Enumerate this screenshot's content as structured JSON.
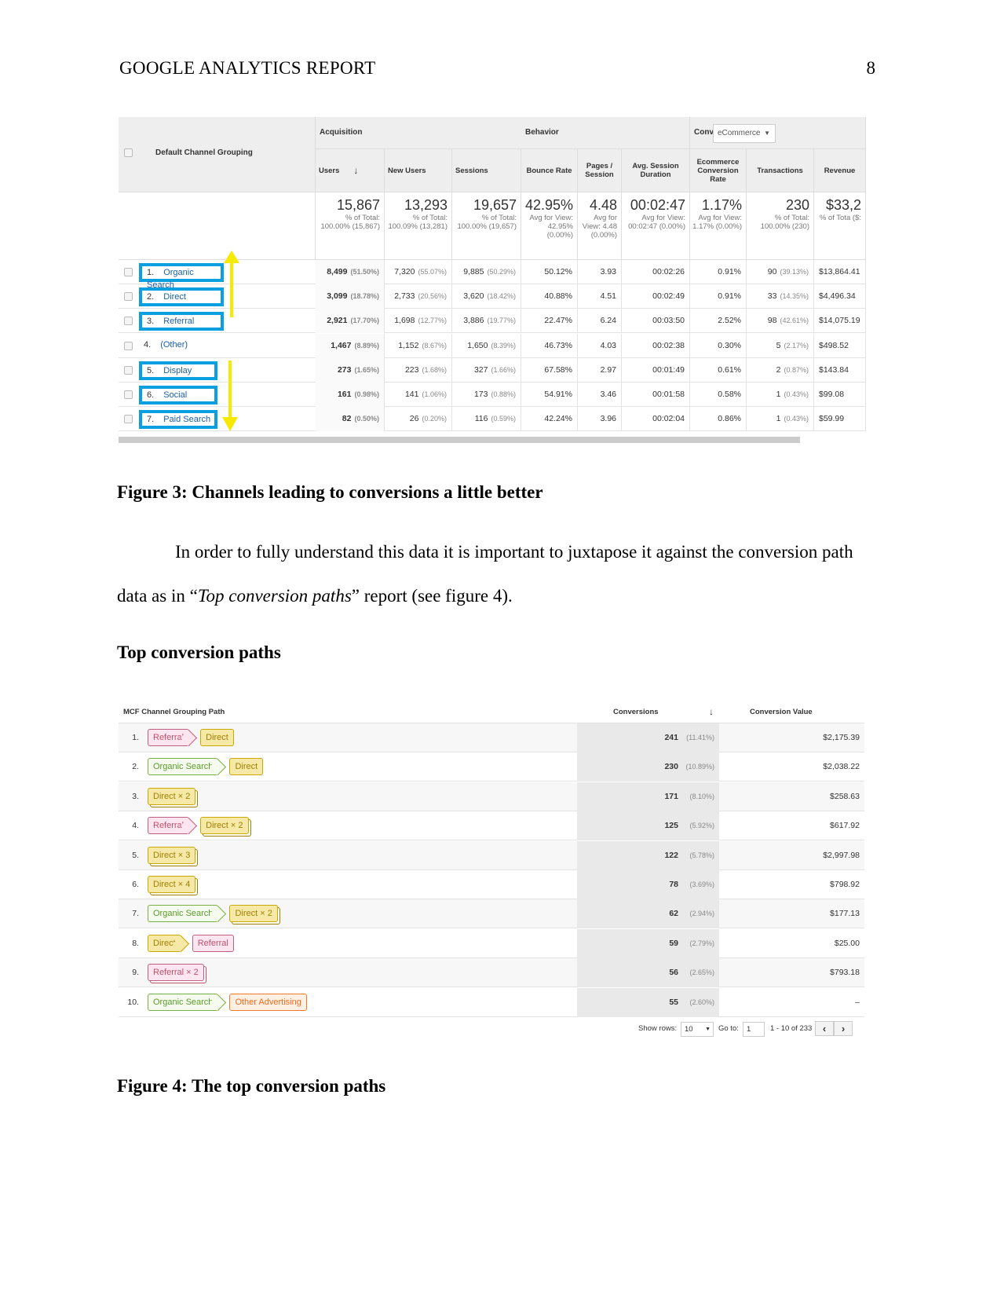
{
  "header": {
    "title": "GOOGLE ANALYTICS REPORT",
    "page_number": "8"
  },
  "figure3": {
    "caption": "Figure 3: Channels leading to conversions a little better",
    "group_headers": {
      "acquisition": "Acquisition",
      "behavior": "Behavior",
      "conversions": "Conversions",
      "conversions_select": "eCommerce"
    },
    "dimension_header": "Default Channel Grouping",
    "columns": [
      "Users",
      "New Users",
      "Sessions",
      "Bounce Rate",
      "Pages / Session",
      "Avg. Session Duration",
      "Ecommerce Conversion Rate",
      "Transactions",
      "Revenue"
    ],
    "totals": [
      {
        "value": "15,867",
        "sub": "% of Total: 100.00% (15,867)"
      },
      {
        "value": "13,293",
        "sub": "% of Total: 100.09% (13,281)"
      },
      {
        "value": "19,657",
        "sub": "% of Total: 100.00% (19,657)"
      },
      {
        "value": "42.95%",
        "sub": "Avg for View: 42.95% (0.00%)"
      },
      {
        "value": "4.48",
        "sub": "Avg for View: 4.48 (0.00%)"
      },
      {
        "value": "00:02:47",
        "sub": "Avg for View: 00:02:47 (0.00%)"
      },
      {
        "value": "1.17%",
        "sub": "Avg for View: 1.17% (0.00%)"
      },
      {
        "value": "230",
        "sub": "% of Total: 100.00% (230)"
      },
      {
        "value": "$33,2",
        "sub": "% of Tota ($:"
      }
    ],
    "rows": [
      {
        "n": "1.",
        "channel": "Organic Search",
        "hl": true,
        "users": "8,499",
        "users_pct": "(51.50%)",
        "new": "7,320",
        "new_pct": "(55.07%)",
        "sessions": "9,885",
        "sessions_pct": "(50.29%)",
        "bounce": "50.12%",
        "pages": "3.93",
        "dur": "00:02:26",
        "conv": "0.91%",
        "trans": "90",
        "trans_pct": "(39.13%)",
        "rev": "$13,864.41"
      },
      {
        "n": "2.",
        "channel": "Direct",
        "hl": true,
        "users": "3,099",
        "users_pct": "(18.78%)",
        "new": "2,733",
        "new_pct": "(20.56%)",
        "sessions": "3,620",
        "sessions_pct": "(18.42%)",
        "bounce": "40.88%",
        "pages": "4.51",
        "dur": "00:02:49",
        "conv": "0.91%",
        "trans": "33",
        "trans_pct": "(14.35%)",
        "rev": "$4,496.34"
      },
      {
        "n": "3.",
        "channel": "Referral",
        "hl": true,
        "users": "2,921",
        "users_pct": "(17.70%)",
        "new": "1,698",
        "new_pct": "(12.77%)",
        "sessions": "3,886",
        "sessions_pct": "(19.77%)",
        "bounce": "22.47%",
        "pages": "6.24",
        "dur": "00:03:50",
        "conv": "2.52%",
        "trans": "98",
        "trans_pct": "(42.61%)",
        "rev": "$14,075.19"
      },
      {
        "n": "4.",
        "channel": "(Other)",
        "hl": false,
        "users": "1,467",
        "users_pct": "(8.89%)",
        "new": "1,152",
        "new_pct": "(8.67%)",
        "sessions": "1,650",
        "sessions_pct": "(8.39%)",
        "bounce": "46.73%",
        "pages": "4.03",
        "dur": "00:02:38",
        "conv": "0.30%",
        "trans": "5",
        "trans_pct": "(2.17%)",
        "rev": "$498.52"
      },
      {
        "n": "5.",
        "channel": "Display",
        "hl": true,
        "users": "273",
        "users_pct": "(1.65%)",
        "new": "223",
        "new_pct": "(1.68%)",
        "sessions": "327",
        "sessions_pct": "(1.66%)",
        "bounce": "67.58%",
        "pages": "2.97",
        "dur": "00:01:49",
        "conv": "0.61%",
        "trans": "2",
        "trans_pct": "(0.87%)",
        "rev": "$143.84"
      },
      {
        "n": "6.",
        "channel": "Social",
        "hl": true,
        "users": "161",
        "users_pct": "(0.98%)",
        "new": "141",
        "new_pct": "(1.06%)",
        "sessions": "173",
        "sessions_pct": "(0.88%)",
        "bounce": "54.91%",
        "pages": "3.46",
        "dur": "00:01:58",
        "conv": "0.58%",
        "trans": "1",
        "trans_pct": "(0.43%)",
        "rev": "$99.08"
      },
      {
        "n": "7.",
        "channel": "Paid Search",
        "hl": true,
        "users": "82",
        "users_pct": "(0.50%)",
        "new": "26",
        "new_pct": "(0.20%)",
        "sessions": "116",
        "sessions_pct": "(0.59%)",
        "bounce": "42.24%",
        "pages": "3.96",
        "dur": "00:02:04",
        "conv": "0.86%",
        "trans": "1",
        "trans_pct": "(0.43%)",
        "rev": "$59.99"
      }
    ],
    "colors": {
      "highlight": "#0a9fe0",
      "arrow": "#f7e900"
    }
  },
  "body": {
    "para_before": "In order to fully understand this data it is important to juxtapose it against the conversion path data as in “",
    "para_italic": "Top conversion paths",
    "para_after": "” report (see figure 4).",
    "heading": "Top conversion paths"
  },
  "figure4": {
    "caption": "Figure 4: The top conversion paths",
    "headers": {
      "path": "MCF Channel Grouping Path",
      "conversions": "Conversions",
      "value": "Conversion Value"
    },
    "rows": [
      {
        "n": "1.",
        "path": [
          {
            "t": "Referral",
            "c": "ref"
          },
          {
            "t": "Direct",
            "c": "dir"
          }
        ],
        "conv": "241",
        "pct": "(11.41%)",
        "value": "$2,175.39"
      },
      {
        "n": "2.",
        "path": [
          {
            "t": "Organic Search",
            "c": "org"
          },
          {
            "t": "Direct",
            "c": "dir"
          }
        ],
        "conv": "230",
        "pct": "(10.89%)",
        "value": "$2,038.22"
      },
      {
        "n": "3.",
        "path": [
          {
            "t": "Direct × 2",
            "c": "dir",
            "m": true
          }
        ],
        "conv": "171",
        "pct": "(8.10%)",
        "value": "$258.63"
      },
      {
        "n": "4.",
        "path": [
          {
            "t": "Referral",
            "c": "ref"
          },
          {
            "t": "Direct × 2",
            "c": "dir",
            "m": true
          }
        ],
        "conv": "125",
        "pct": "(5.92%)",
        "value": "$617.92"
      },
      {
        "n": "5.",
        "path": [
          {
            "t": "Direct × 3",
            "c": "dir",
            "m": true
          }
        ],
        "conv": "122",
        "pct": "(5.78%)",
        "value": "$2,997.98"
      },
      {
        "n": "6.",
        "path": [
          {
            "t": "Direct × 4",
            "c": "dir",
            "m": true
          }
        ],
        "conv": "78",
        "pct": "(3.69%)",
        "value": "$798.92"
      },
      {
        "n": "7.",
        "path": [
          {
            "t": "Organic Search",
            "c": "org"
          },
          {
            "t": "Direct × 2",
            "c": "dir",
            "m": true
          }
        ],
        "conv": "62",
        "pct": "(2.94%)",
        "value": "$177.13"
      },
      {
        "n": "8.",
        "path": [
          {
            "t": "Direct",
            "c": "dir"
          },
          {
            "t": "Referral",
            "c": "ref"
          }
        ],
        "conv": "59",
        "pct": "(2.79%)",
        "value": "$25.00"
      },
      {
        "n": "9.",
        "path": [
          {
            "t": "Referral × 2",
            "c": "ref",
            "m": true
          }
        ],
        "conv": "56",
        "pct": "(2.65%)",
        "value": "$793.18"
      },
      {
        "n": "10.",
        "path": [
          {
            "t": "Organic Search",
            "c": "org"
          },
          {
            "t": "Other Advertising",
            "c": "oth"
          }
        ],
        "conv": "55",
        "pct": "(2.60%)",
        "value": "–"
      }
    ],
    "footer": {
      "show_rows_label": "Show rows:",
      "show_rows_value": "10",
      "goto_label": "Go to:",
      "goto_value": "1",
      "range": "1 - 10 of 233",
      "prev": "‹",
      "next": "›"
    }
  }
}
